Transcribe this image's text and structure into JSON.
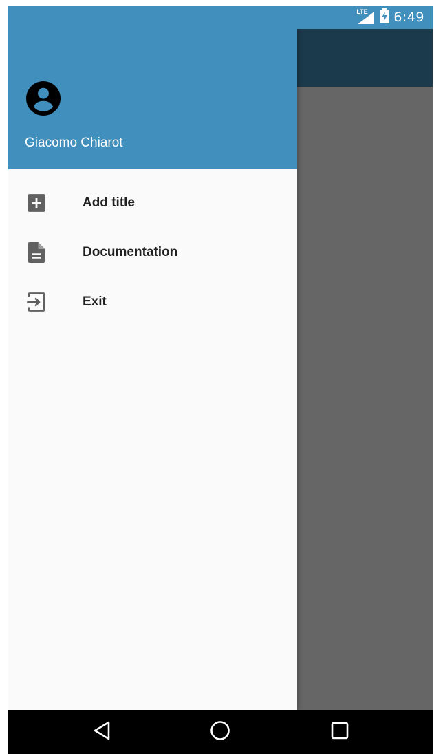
{
  "status_bar": {
    "network": "LTE",
    "time": "6:49"
  },
  "drawer": {
    "header": {
      "user_name": "Giacomo Chiarot",
      "avatar_icon": "account-circle-icon",
      "background_color": "#418fbd"
    },
    "menu_items": [
      {
        "label": "Add title",
        "icon": "add-box-icon"
      },
      {
        "label": "Documentation",
        "icon": "document-icon"
      },
      {
        "label": "Exit",
        "icon": "exit-icon"
      }
    ]
  },
  "navigation_bar": {
    "buttons": [
      {
        "icon": "back-icon"
      },
      {
        "icon": "home-icon"
      },
      {
        "icon": "recents-icon"
      }
    ]
  },
  "colors": {
    "accent": "#418fbd",
    "toolbar_dark": "#1b3a4c",
    "scrim": "#666666",
    "drawer_background": "#fafafa",
    "icon_gray": "#616161"
  }
}
